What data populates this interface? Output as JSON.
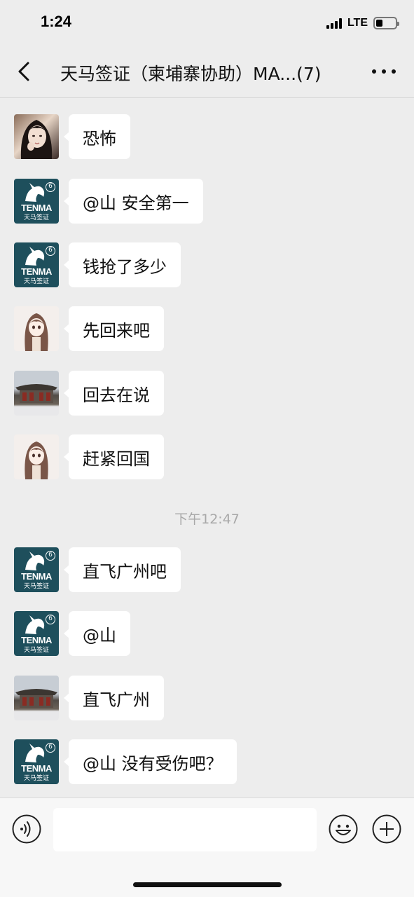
{
  "status": {
    "time": "1:24",
    "network": "LTE",
    "battery_level": 0.3
  },
  "header": {
    "title": "天马签证（柬埔寨协助）MA...(7)",
    "back_icon": "chevron-left-icon",
    "more_icon": "more-dots-icon"
  },
  "avatar_text": {
    "tenma_word": "TENMA",
    "tenma_cn": "天马签证",
    "tenma_num": "6"
  },
  "messages": [
    {
      "sender": "woman",
      "text": "恐怖"
    },
    {
      "sender": "tenma",
      "text": "@山 安全第一"
    },
    {
      "sender": "tenma",
      "text": "钱抢了多少"
    },
    {
      "sender": "anime-girl",
      "text": "先回来吧"
    },
    {
      "sender": "temple",
      "text": "回去在说"
    },
    {
      "sender": "anime-girl",
      "text": "赶紧回国"
    },
    {
      "sender": "tenma",
      "text": "直飞广州吧"
    },
    {
      "sender": "tenma",
      "text": "@山"
    },
    {
      "sender": "temple",
      "text": "直飞广州"
    },
    {
      "sender": "tenma",
      "text": "@山 没有受伤吧？"
    }
  ],
  "timestamp": "下午12:47",
  "input_bar": {
    "voice_icon": "voice-icon",
    "emoji_icon": "emoji-icon",
    "plus_icon": "plus-icon",
    "input_value": ""
  },
  "colors": {
    "background": "#ededed",
    "bubble": "#ffffff",
    "tenma_brand": "#1e4f5c",
    "timestamp": "#a8a8a8"
  }
}
